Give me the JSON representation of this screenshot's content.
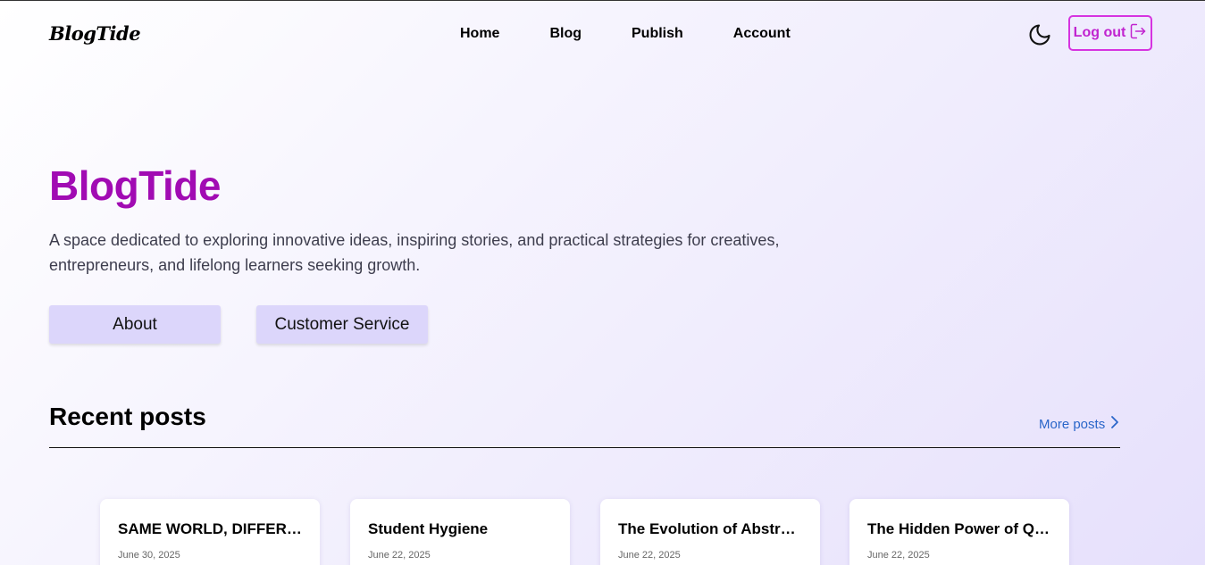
{
  "header": {
    "logo": "BlogTide",
    "nav": [
      "Home",
      "Blog",
      "Publish",
      "Account"
    ],
    "logout_label": "Log out"
  },
  "hero": {
    "title": "BlogTide",
    "description": "A space dedicated to exploring innovative ideas, inspiring stories, and practical strategies for creatives, entrepreneurs, and lifelong learners seeking growth.",
    "buttons": [
      "About",
      "Customer Service"
    ]
  },
  "recent": {
    "title": "Recent posts",
    "more_label": "More posts",
    "posts": [
      {
        "title": "SAME WORLD, DIFFERENT ...",
        "date": "June 30, 2025"
      },
      {
        "title": "Student Hygiene",
        "date": "June 22, 2025"
      },
      {
        "title": "The Evolution of Abstract ...",
        "date": "June 22, 2025"
      },
      {
        "title": "The Hidden Power of Quan...",
        "date": "June 22, 2025"
      }
    ]
  },
  "colors": {
    "accent": "#a10bb3",
    "logout_border": "#d633e0",
    "button_bg": "#dcd6fb",
    "link": "#2a66c9"
  },
  "icons": {
    "theme_toggle": "moon-icon",
    "logout": "logout-icon",
    "more": "chevron-right-icon"
  }
}
